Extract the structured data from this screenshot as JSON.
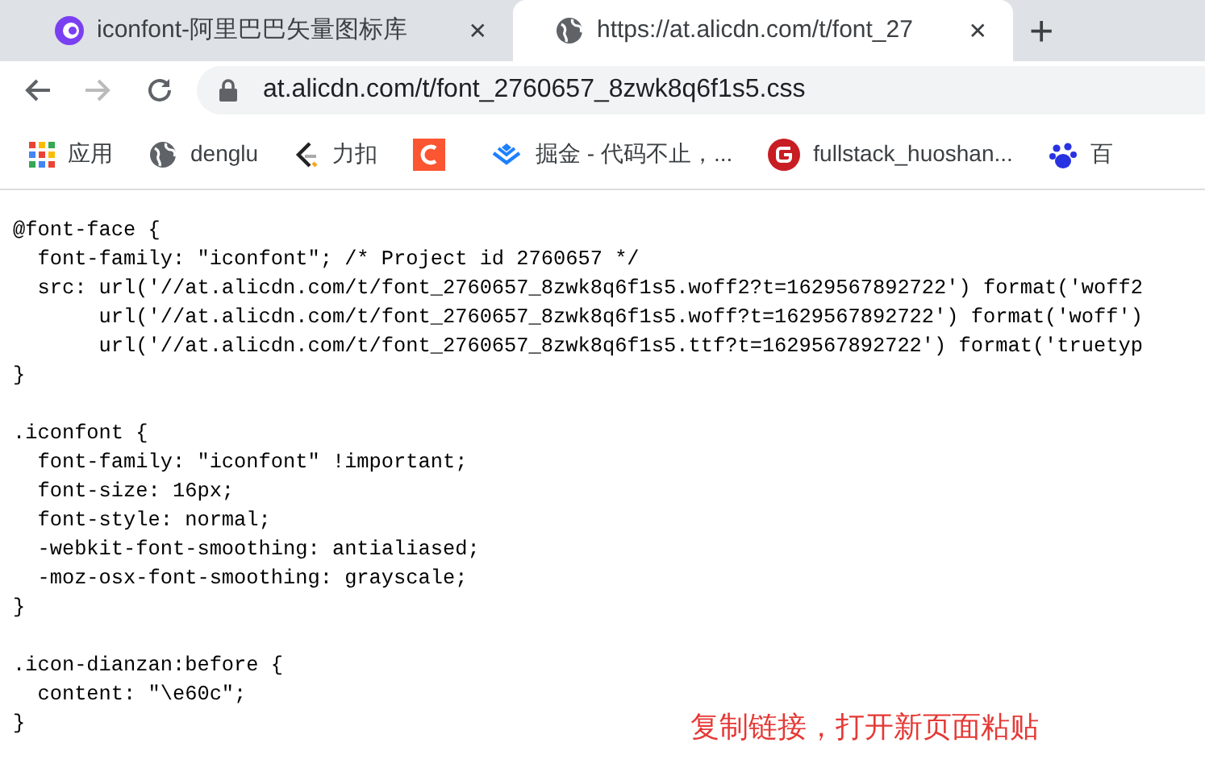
{
  "tabs": [
    {
      "title": "iconfont-阿里巴巴矢量图标库",
      "close": "✕",
      "selected": false
    },
    {
      "title": "https://at.alicdn.com/t/font_27",
      "close": "✕",
      "selected": true
    }
  ],
  "new_tab": "+",
  "address_bar": {
    "url": "at.alicdn.com/t/font_2760657_8zwk8q6f1s5.css"
  },
  "bookmarks": [
    {
      "kind": "labeled",
      "label": "应用"
    },
    {
      "kind": "labeled",
      "label": "denglu"
    },
    {
      "kind": "labeled",
      "label": "力扣"
    },
    {
      "kind": "icon"
    },
    {
      "kind": "labeled",
      "label": "掘金 - 代码不止，..."
    },
    {
      "kind": "labeled",
      "label": "fullstack_huoshan..."
    },
    {
      "kind": "labeled",
      "label": "百"
    }
  ],
  "code_blocks": [
    {
      "lines": [
        "@font-face {",
        "  font-family: \"iconfont\"; /* Project id 2760657 */",
        "  src: url('//at.alicdn.com/t/font_2760657_8zwk8q6f1s5.woff2?t=1629567892722') format('woff2",
        "       url('//at.alicdn.com/t/font_2760657_8zwk8q6f1s5.woff?t=1629567892722') format('woff')",
        "       url('//at.alicdn.com/t/font_2760657_8zwk8q6f1s5.ttf?t=1629567892722') format('truetyp",
        "}"
      ]
    },
    {
      "lines": [
        ".iconfont {",
        "  font-family: \"iconfont\" !important;",
        "  font-size: 16px;",
        "  font-style: normal;",
        "  -webkit-font-smoothing: antialiased;",
        "  -moz-osx-font-smoothing: grayscale;",
        "}"
      ]
    },
    {
      "lines": [
        ".icon-dianzan:before {",
        "  content: \"\\e60c\";",
        "}"
      ]
    }
  ],
  "annotation": "复制链接，打开新页面粘贴"
}
